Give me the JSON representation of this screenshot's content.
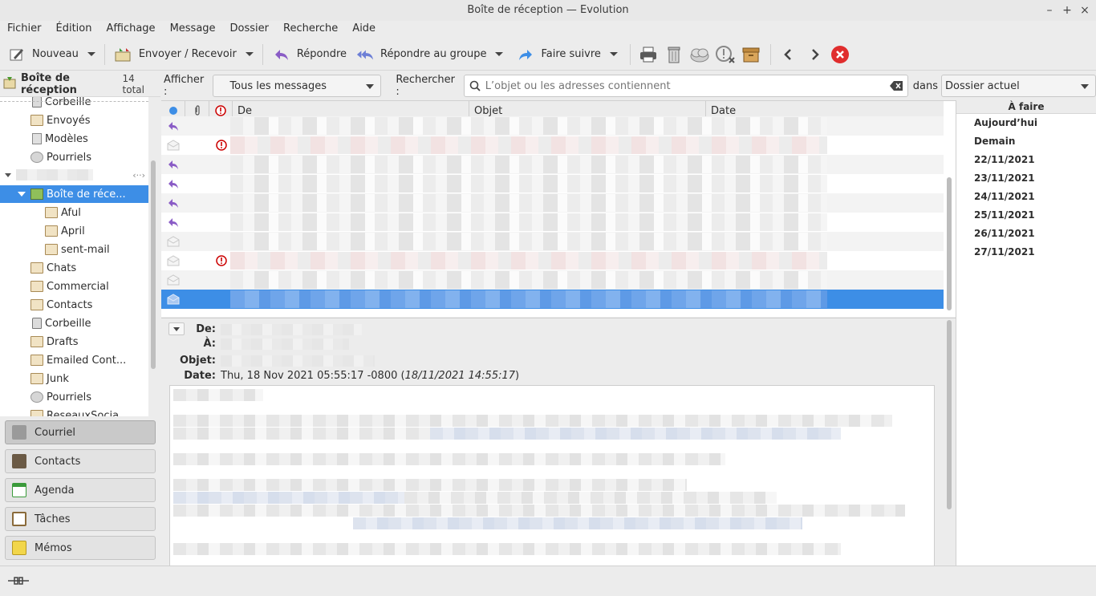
{
  "window": {
    "title": "Boîte de réception — Evolution",
    "controls": [
      "–",
      "+",
      "×"
    ]
  },
  "menu": [
    "Fichier",
    "Édition",
    "Affichage",
    "Message",
    "Dossier",
    "Recherche",
    "Aide"
  ],
  "toolbar": {
    "new": "Nouveau",
    "send_receive": "Envoyer / Recevoir",
    "reply": "Répondre",
    "reply_group": "Répondre au groupe",
    "forward": "Faire suivre"
  },
  "sidebar": {
    "title": "Boîte de réception",
    "count": "14 total",
    "folders_top": [
      "Corbeille",
      "Envoyés",
      "Modèles",
      "Pourriels"
    ],
    "inbox_label": "Boîte de réce...",
    "inbox_children": [
      "Aful",
      "April",
      "sent-mail"
    ],
    "folders": [
      "Chats",
      "Commercial",
      "Contacts",
      "Corbeille",
      "Drafts",
      "Emailed Cont...",
      "Junk",
      "Pourriels",
      "ReseauxSocia..."
    ]
  },
  "switcher": [
    "Courriel",
    "Contacts",
    "Agenda",
    "Tâches",
    "Mémos"
  ],
  "searchbar": {
    "show_label": "Afficher :",
    "show_value": "Tous les messages",
    "search_label": "Rechercher :",
    "search_placeholder": "L’objet ou les adresses contiennent",
    "in_label": "dans",
    "scope_value": "Dossier actuel"
  },
  "message_list": {
    "columns": [
      "De",
      "Objet",
      "Date"
    ],
    "rows": [
      {
        "status": "replied",
        "important": false
      },
      {
        "status": "read",
        "important": true
      },
      {
        "status": "replied",
        "important": false
      },
      {
        "status": "replied",
        "important": false
      },
      {
        "status": "replied",
        "important": false
      },
      {
        "status": "replied",
        "important": false
      },
      {
        "status": "read",
        "important": false
      },
      {
        "status": "read",
        "important": true
      },
      {
        "status": "read",
        "important": false
      },
      {
        "status": "read",
        "important": false,
        "selected": true
      }
    ]
  },
  "preview": {
    "from_label": "De:",
    "to_label": "À:",
    "subject_label": "Objet:",
    "date_label": "Date:",
    "date_value": "Thu, 18 Nov 2021 05:55:17 -0800 (",
    "date_local": "18/11/2021 14:55:17",
    "date_close": ")"
  },
  "todo": {
    "title": "À faire",
    "items": [
      "Aujourd’hui",
      "Demain",
      "22/11/2021",
      "23/11/2021",
      "24/11/2021",
      "25/11/2021",
      "26/11/2021",
      "27/11/2021"
    ]
  },
  "colors": {
    "selection": "#3d8ee6",
    "important": "#cc0000",
    "reply_arrow": "#8a5cc6"
  }
}
